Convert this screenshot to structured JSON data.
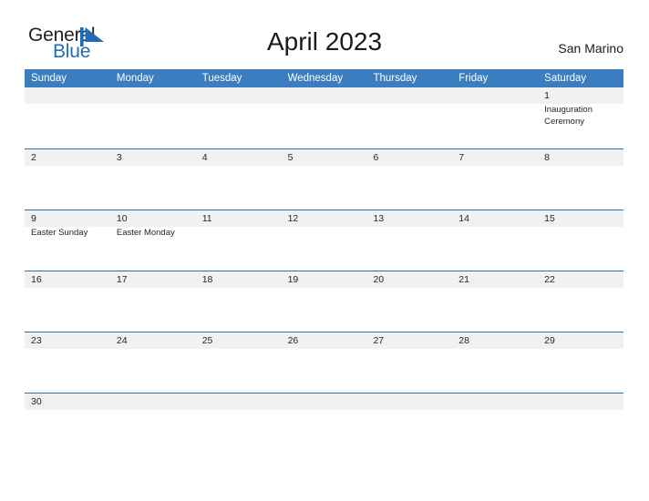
{
  "brand": {
    "name_part1": "General",
    "name_part2": "Blue",
    "mark": "triangle-logo-icon"
  },
  "header": {
    "title": "April 2023",
    "country": "San Marino"
  },
  "colors": {
    "header_blue": "#3a7ebf",
    "row_line_blue": "#2f6ca8",
    "band_gray": "#f1f1f1",
    "logo_blue": "#1f6eb5",
    "text": "#262626"
  },
  "calendar": {
    "weekdays": [
      "Sunday",
      "Monday",
      "Tuesday",
      "Wednesday",
      "Thursday",
      "Friday",
      "Saturday"
    ],
    "weeks": [
      {
        "days": [
          {
            "num": "",
            "events": []
          },
          {
            "num": "",
            "events": []
          },
          {
            "num": "",
            "events": []
          },
          {
            "num": "",
            "events": []
          },
          {
            "num": "",
            "events": []
          },
          {
            "num": "",
            "events": []
          },
          {
            "num": "1",
            "events": [
              "Inauguration Ceremony"
            ]
          }
        ]
      },
      {
        "days": [
          {
            "num": "2",
            "events": []
          },
          {
            "num": "3",
            "events": []
          },
          {
            "num": "4",
            "events": []
          },
          {
            "num": "5",
            "events": []
          },
          {
            "num": "6",
            "events": []
          },
          {
            "num": "7",
            "events": []
          },
          {
            "num": "8",
            "events": []
          }
        ]
      },
      {
        "days": [
          {
            "num": "9",
            "events": [
              "Easter Sunday"
            ]
          },
          {
            "num": "10",
            "events": [
              "Easter Monday"
            ]
          },
          {
            "num": "11",
            "events": []
          },
          {
            "num": "12",
            "events": []
          },
          {
            "num": "13",
            "events": []
          },
          {
            "num": "14",
            "events": []
          },
          {
            "num": "15",
            "events": []
          }
        ]
      },
      {
        "days": [
          {
            "num": "16",
            "events": []
          },
          {
            "num": "17",
            "events": []
          },
          {
            "num": "18",
            "events": []
          },
          {
            "num": "19",
            "events": []
          },
          {
            "num": "20",
            "events": []
          },
          {
            "num": "21",
            "events": []
          },
          {
            "num": "22",
            "events": []
          }
        ]
      },
      {
        "days": [
          {
            "num": "23",
            "events": []
          },
          {
            "num": "24",
            "events": []
          },
          {
            "num": "25",
            "events": []
          },
          {
            "num": "26",
            "events": []
          },
          {
            "num": "27",
            "events": []
          },
          {
            "num": "28",
            "events": []
          },
          {
            "num": "29",
            "events": []
          }
        ]
      },
      {
        "last": true,
        "days": [
          {
            "num": "30",
            "events": []
          },
          {
            "num": "",
            "events": []
          },
          {
            "num": "",
            "events": []
          },
          {
            "num": "",
            "events": []
          },
          {
            "num": "",
            "events": []
          },
          {
            "num": "",
            "events": []
          },
          {
            "num": "",
            "events": []
          }
        ]
      }
    ]
  }
}
